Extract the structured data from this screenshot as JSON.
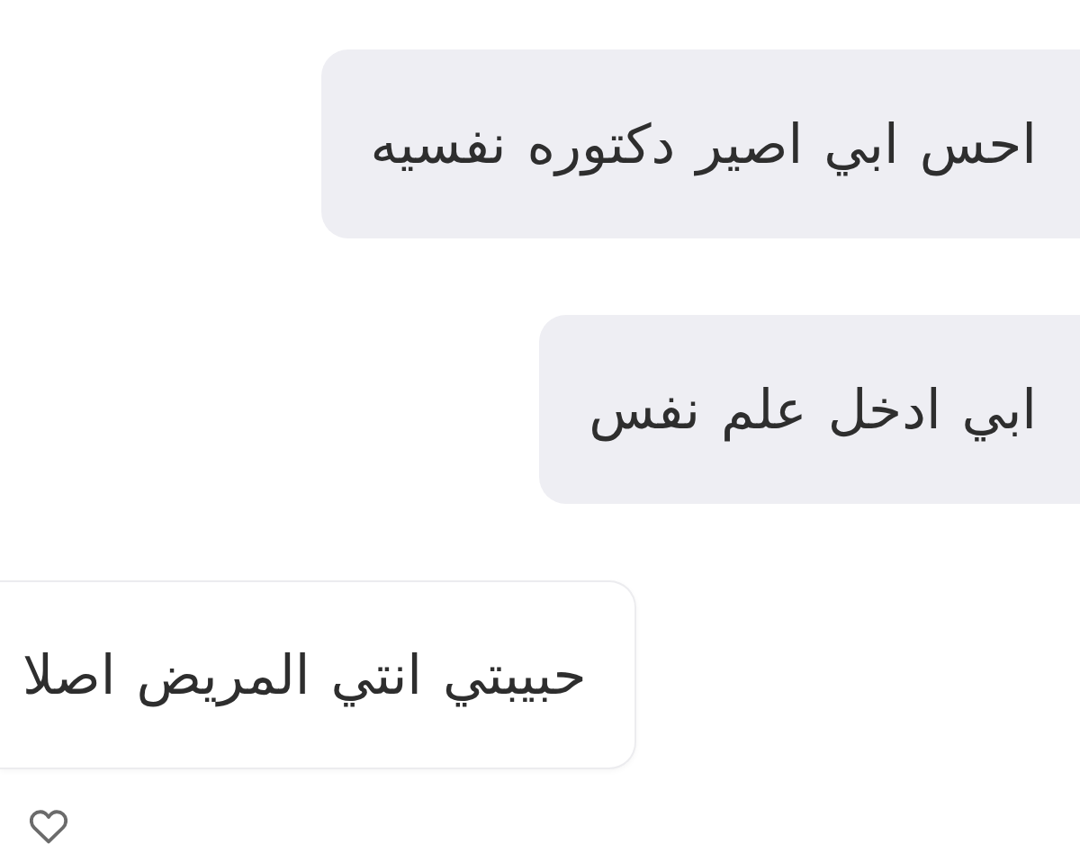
{
  "messages": [
    {
      "kind": "sent",
      "text": "احس ابي اصير دكتوره نفسيه"
    },
    {
      "kind": "sent",
      "text": "ابي ادخل علم نفس"
    },
    {
      "kind": "received",
      "text": "حبيبتي انتي المريض اصلا",
      "liked": false
    }
  ]
}
